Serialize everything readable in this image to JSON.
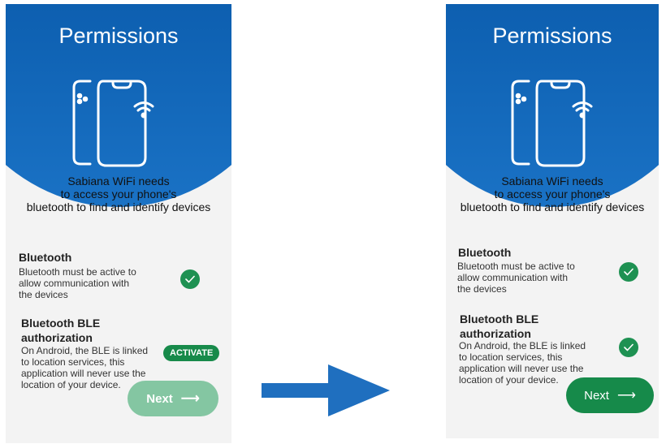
{
  "screens": [
    {
      "title": "Permissions",
      "intro": {
        "line1": "Sabiana WiFi needs",
        "line2": "to access your phone's",
        "line3": "bluetooth to find and identify devices"
      },
      "bluetooth": {
        "title": "Bluetooth",
        "desc1": "Bluetooth must be active to",
        "desc2": "allow communication with",
        "desc3": "the devices"
      },
      "ble": {
        "title1": "Bluetooth BLE",
        "title2": "authorization",
        "desc1": "On Android, the BLE is linked",
        "desc2": "to location services, this",
        "desc3": "application will never use the",
        "desc4": "location of your device.",
        "action_label": "ACTIVATE"
      },
      "next_label": "Next",
      "next_state": "disabled"
    },
    {
      "title": "Permissions",
      "intro": {
        "line1": "Sabiana WiFi needs",
        "line2": "to access your phone's",
        "line3": "bluetooth to find and identify devices"
      },
      "bluetooth": {
        "title": "Bluetooth",
        "desc1": "Bluetooth must be active to",
        "desc2": "allow communication with",
        "desc3": "the devices"
      },
      "ble": {
        "title1": "Bluetooth BLE",
        "title2": "authorization",
        "desc1": "On Android, the BLE is linked",
        "desc2": "to location services, this",
        "desc3": "application will never use the",
        "desc4": "location of your device."
      },
      "next_label": "Next",
      "next_state": "enabled"
    }
  ],
  "colors": {
    "header_blue": "#0f62b4",
    "check_green": "#1e9152",
    "button_green": "#168a4a",
    "button_disabled": "#84c6a2",
    "arrow_blue": "#1f6fbf"
  },
  "icons": {
    "hero": "phones-wifi-icon",
    "status": "check-icon",
    "next": "arrow-right-icon",
    "flow": "flow-arrow-icon"
  }
}
